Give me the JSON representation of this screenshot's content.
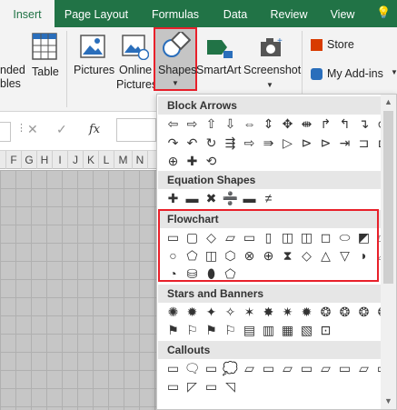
{
  "tabs": [
    "Insert",
    "Page Layout",
    "Formulas",
    "Data",
    "Review",
    "View"
  ],
  "ribbon": {
    "partial_group": [
      "nded",
      "bles"
    ],
    "table": "Table",
    "pictures": "Pictures",
    "online_pictures": [
      "Online",
      "Pictures"
    ],
    "shapes": "Shapes",
    "smartart": "SmartArt",
    "screenshot": "Screenshot",
    "store": "Store",
    "addins": "My Add-ins"
  },
  "formula_bar": {
    "fx": "fx"
  },
  "columns": [
    "F",
    "G",
    "H",
    "I",
    "J",
    "K",
    "L",
    "M",
    "N"
  ],
  "gallery": {
    "sections": [
      {
        "title": "Block Arrows",
        "rows": [
          [
            "⇦",
            "⇨",
            "⇧",
            "⇩",
            "⇔",
            "⇕",
            "✥",
            "⇼",
            "↱",
            "↰",
            "↴",
            "⮎"
          ],
          [
            "↷",
            "↶",
            "↻",
            "⇶",
            "⇨",
            "⇛",
            "▷",
            "⊳",
            "⊳",
            "⇥",
            "⊐",
            "⊏"
          ],
          [
            "⊕",
            "✚",
            "⟲"
          ]
        ]
      },
      {
        "title": "Equation Shapes",
        "rows": [
          [
            "✚",
            "▬",
            "✖",
            "➗",
            "▬",
            "≠"
          ]
        ]
      },
      {
        "title": "Flowchart",
        "rows": [
          [
            "▭",
            "▢",
            "◇",
            "▱",
            "▭",
            "▯",
            "◫",
            "◫",
            "◻",
            "⬭",
            "◩",
            "⏢"
          ],
          [
            "○",
            "⬠",
            "◫",
            "⬡",
            "⊗",
            "⊕",
            "⧗",
            "◇",
            "△",
            "▽",
            "◗",
            "⌓"
          ],
          [
            "◔",
            "⛁",
            "⬮",
            "⬠"
          ]
        ]
      },
      {
        "title": "Stars and Banners",
        "rows": [
          [
            "✺",
            "✹",
            "✦",
            "✧",
            "✶",
            "✸",
            "✷",
            "✹",
            "❂",
            "❂",
            "❂",
            "❂"
          ],
          [
            "⚑",
            "⚐",
            "⚑",
            "⚐",
            "▤",
            "▥",
            "▦",
            "▧",
            "⊡"
          ]
        ]
      },
      {
        "title": "Callouts",
        "rows": [
          [
            "▭",
            "🗨",
            "▭",
            "💭",
            "▱",
            "▭",
            "▱",
            "▭",
            "▱",
            "▭",
            "▱",
            "▭"
          ],
          [
            "▭",
            "◸",
            "▭",
            "◹"
          ]
        ]
      }
    ]
  },
  "colors": {
    "accent": "#217346",
    "highlight": "#e8202a"
  }
}
